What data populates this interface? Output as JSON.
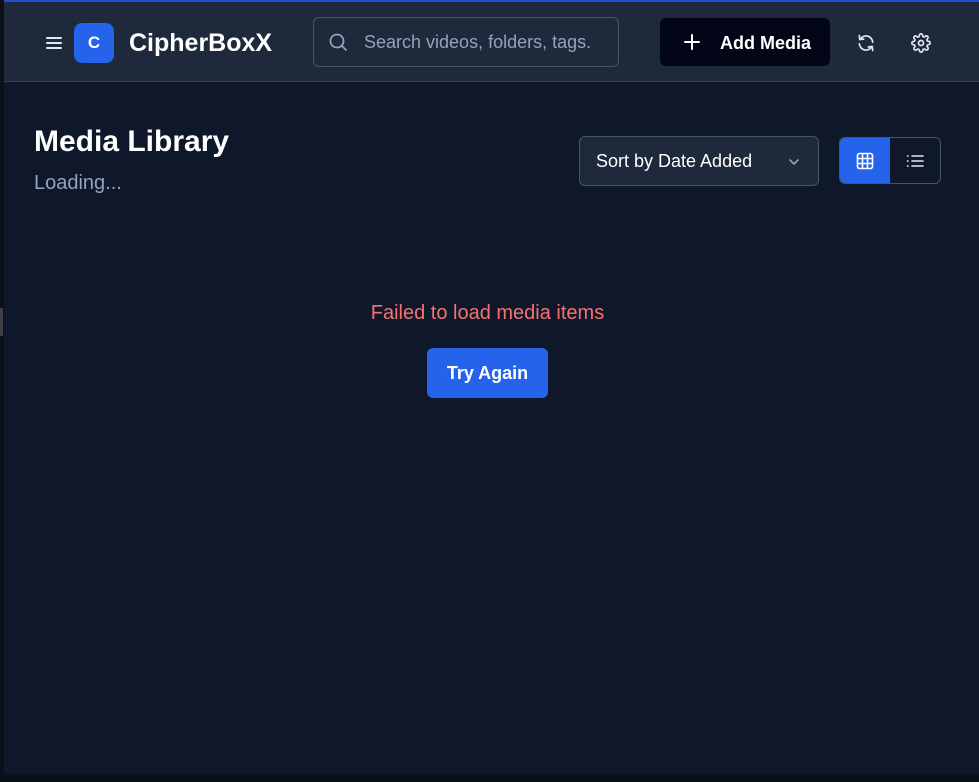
{
  "header": {
    "menu_icon": "hamburger-menu-icon",
    "logo_letter": "C",
    "app_title": "CipherBoxX",
    "search": {
      "placeholder": "Search videos, folders, tags.",
      "value": "",
      "icon": "search-icon"
    },
    "add_media_label": "Add Media",
    "add_media_icon": "plus-icon",
    "refresh_icon": "refresh-icon",
    "settings_icon": "gear-icon"
  },
  "main": {
    "title": "Media Library",
    "subtitle": "Loading...",
    "sort": {
      "selected": "Sort by Date Added",
      "icon": "chevron-down-icon"
    },
    "view_toggle": {
      "active": "grid",
      "grid_icon": "grid-icon",
      "list_icon": "list-icon"
    },
    "error": {
      "message": "Failed to load media items",
      "retry_label": "Try Again"
    }
  },
  "colors": {
    "background": "#0f172a",
    "header_bg": "#1e293b",
    "accent": "#2563eb",
    "error": "#f87171",
    "muted_text": "#94a3b8"
  }
}
